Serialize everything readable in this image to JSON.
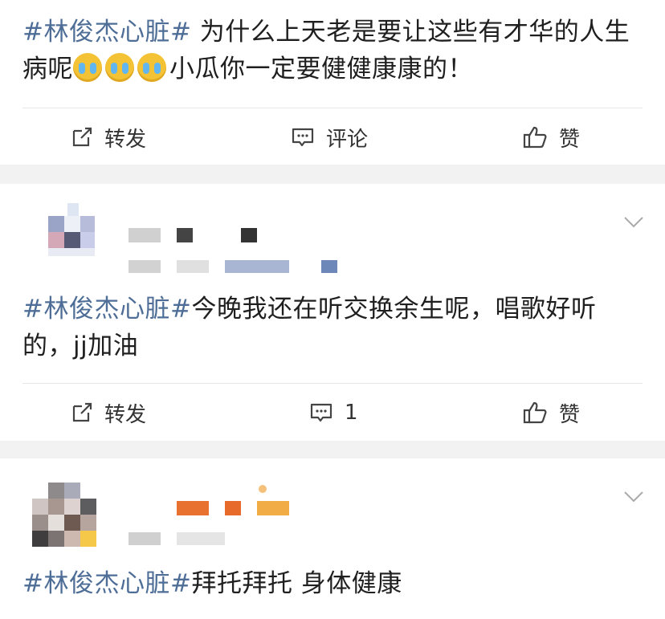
{
  "posts": [
    {
      "topic": "#林俊杰心脏#",
      "text_a": " 为什么上天老是要让这些有才华的人生病呢",
      "emojis": [
        "crying-face",
        "crying-face",
        "crying-face"
      ],
      "text_b": "小瓜你一定要健健康康的！",
      "actions": {
        "repost": "转发",
        "comment": "评论",
        "like": "赞"
      }
    },
    {
      "topic": "#林俊杰心脏#",
      "text": "今晚我还在听交换余生呢，唱歌好听的，jj加油",
      "actions": {
        "repost": "转发",
        "comment": "1",
        "like": "赞"
      }
    },
    {
      "topic": "#林俊杰心脏#",
      "text": "拜托拜托 身体健康"
    }
  ],
  "colors": {
    "topic": "#4e6e97",
    "separator": "#f2f2f2",
    "text": "#1f1f1f"
  }
}
